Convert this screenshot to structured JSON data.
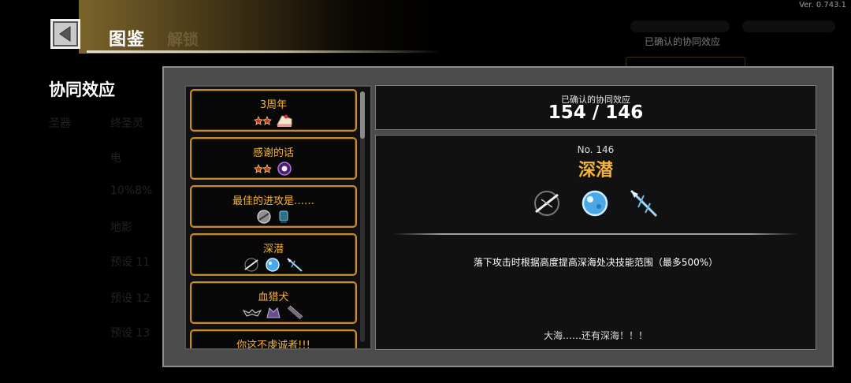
{
  "version": "Ver. 0.743.1",
  "header": {
    "title": "图鉴",
    "faded_tab": "解锁",
    "top_right_label": "已确认的协同效应"
  },
  "section_title": "协同效应",
  "background_list": {
    "col1": [
      "圣器"
    ],
    "col2": [
      "终圣灵",
      "电",
      "10%8%",
      "地影",
      "预设 11",
      "预设 12",
      "预设 13"
    ]
  },
  "synergy_list": [
    {
      "name": "3周年",
      "icons": [
        "mini-stars-icon",
        "cake-slice-icon"
      ]
    },
    {
      "name": "感谢的话",
      "icons": [
        "mini-stars-icon",
        "purple-orb-icon"
      ]
    },
    {
      "name": "最佳的进攻是……",
      "icons": [
        "grey-shield-icon",
        "blue-gauntlet-icon"
      ]
    },
    {
      "name": "深潜",
      "icons": [
        "silver-dagger-icon",
        "ice-fist-icon",
        "blue-spear-icon"
      ]
    },
    {
      "name": "血猎犬",
      "icons": [
        "bat-icon",
        "purple-beast-icon",
        "dark-claw-icon"
      ]
    },
    {
      "name": "你这不虔诚者!!!",
      "icons": []
    }
  ],
  "confirmed": {
    "label": "已确认的协同效应",
    "value": "154 / 146"
  },
  "detail": {
    "number": "No. 146",
    "name": "深潜",
    "icons": [
      "silver-dagger-icon",
      "ice-fist-icon",
      "blue-spear-icon"
    ],
    "description": "落下攻击时根据高度提高深海处决技能范围（最多500%）",
    "flavor": "大海……还有深海！！！"
  },
  "colors": {
    "accent": "#f2b43a",
    "item_border": "#c68a30",
    "panel_bg": "#4b4b4b"
  }
}
